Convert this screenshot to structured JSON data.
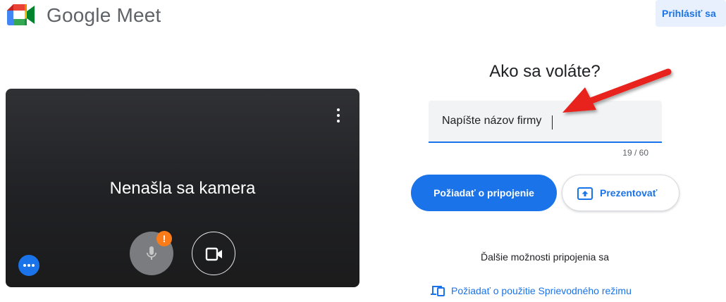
{
  "header": {
    "app_title": "Google Meet",
    "signin_label": "Prihlásiť sa"
  },
  "preview": {
    "camera_message": "Nenašla sa kamera",
    "mic_warning_badge": "!"
  },
  "join": {
    "heading": "Ako sa voláte?",
    "name_input_value": "Napíšte názov firmy",
    "char_counter": "19 / 60",
    "join_button_label": "Požiadať o pripojenie",
    "present_button_label": "Prezentovať",
    "other_options_label": "Ďalšie možnosti pripojenia sa",
    "companion_mode_link": "Požiadať o použitie Sprievodného režimu"
  },
  "colors": {
    "accent": "#1a73e8",
    "warning": "#fa7b17",
    "annotation_arrow": "#e8201a"
  },
  "icons": {
    "logo": "google-meet-logo",
    "more": "more-vert-icon",
    "mic": "mic-off-icon",
    "camera": "videocam-icon",
    "effects": "more-horiz-icon",
    "present": "present-to-all-icon",
    "companion": "devices-icon"
  }
}
